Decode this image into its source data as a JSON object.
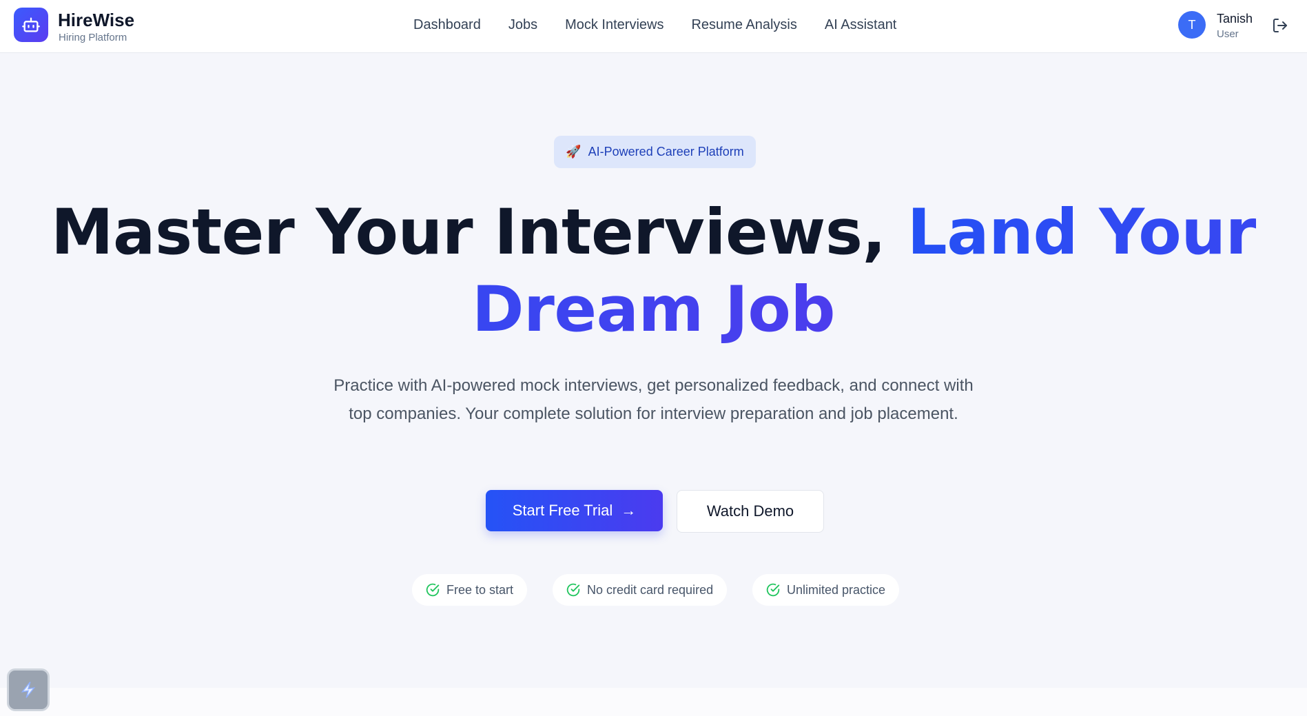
{
  "header": {
    "brand_name": "HireWise",
    "brand_sub": "Hiring Platform",
    "logo_icon": "robot-icon",
    "nav": [
      {
        "label": "Dashboard"
      },
      {
        "label": "Jobs"
      },
      {
        "label": "Mock Interviews"
      },
      {
        "label": "Resume Analysis"
      },
      {
        "label": "AI Assistant"
      }
    ],
    "user": {
      "initial": "T",
      "name": "Tanish",
      "role": "User"
    },
    "logout_icon": "logout-icon"
  },
  "hero": {
    "badge_emoji": "🚀",
    "badge_label": "AI-Powered Career Platform",
    "title_part1": "Master Your Interviews, ",
    "title_part2": "Land Your Dream Job",
    "description": "Practice with AI-powered mock interviews, get personalized feedback, and connect with top companies. Your complete solution for interview preparation and job placement.",
    "primary_cta": "Start Free Trial",
    "primary_cta_arrow": "→",
    "secondary_cta": "Watch Demo",
    "features": [
      {
        "label": "Free to start"
      },
      {
        "label": "No credit card required"
      },
      {
        "label": "Unlimited practice"
      }
    ]
  },
  "colors": {
    "accent": "#2450f5",
    "accent_end": "#4c3ded",
    "check_green": "#22c55e",
    "background": "#f5f6fb"
  }
}
